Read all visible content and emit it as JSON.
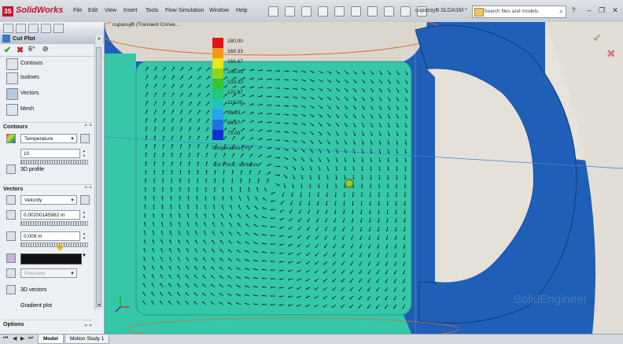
{
  "app": {
    "name": "SolidWorks",
    "menus": [
      "File",
      "Edit",
      "View",
      "Insert",
      "Tools",
      "Flow Simulation",
      "Window",
      "Help"
    ],
    "document_title": "cupassyB.SLDASM *",
    "search_placeholder": "Search files and models"
  },
  "panel": {
    "title": "Cut Plot",
    "help": "?",
    "options": [
      {
        "label": "Contours"
      },
      {
        "label": "Isolines"
      },
      {
        "label": "Vectors"
      },
      {
        "label": "Mesh"
      }
    ],
    "contours": {
      "title": "Contours",
      "parameter": "Temperature",
      "levels": "10",
      "profile_label": "3D profile"
    },
    "vectors": {
      "title": "Vectors",
      "parameter": "Velocity",
      "spacing": "0.00200145982 m",
      "length": "0.009 m",
      "color_param": "Pressure",
      "vectors3d_label": "3D vectors",
      "gradient_label": "Gradient plot"
    },
    "options_section": "Options"
  },
  "viewport": {
    "assembly_label": "cupassyB (Transient Conve...",
    "legend": {
      "title": "Temperature [°F]",
      "values": [
        "180.00",
        "168.33",
        "156.67",
        "145.00",
        "133.33",
        "121.67",
        "110.00",
        "98.33",
        "86.67",
        "75.00"
      ],
      "colors": [
        "#e0151b",
        "#f59a18",
        "#e8e51c",
        "#93d31d",
        "#33c43a",
        "#20c77e",
        "#1fc4bf",
        "#22a6e6",
        "#2070e0",
        "#0d2fd0"
      ]
    },
    "cutplot_name": "Cut Plot 1: contours",
    "watermark": "SolidEngineer"
  },
  "bottom_tabs": [
    "Model",
    "Motion Study 1"
  ],
  "colors": {
    "cup_outer": "#1f5fb8",
    "fluid": "#35c7a8",
    "background": "#d9d5ce"
  }
}
